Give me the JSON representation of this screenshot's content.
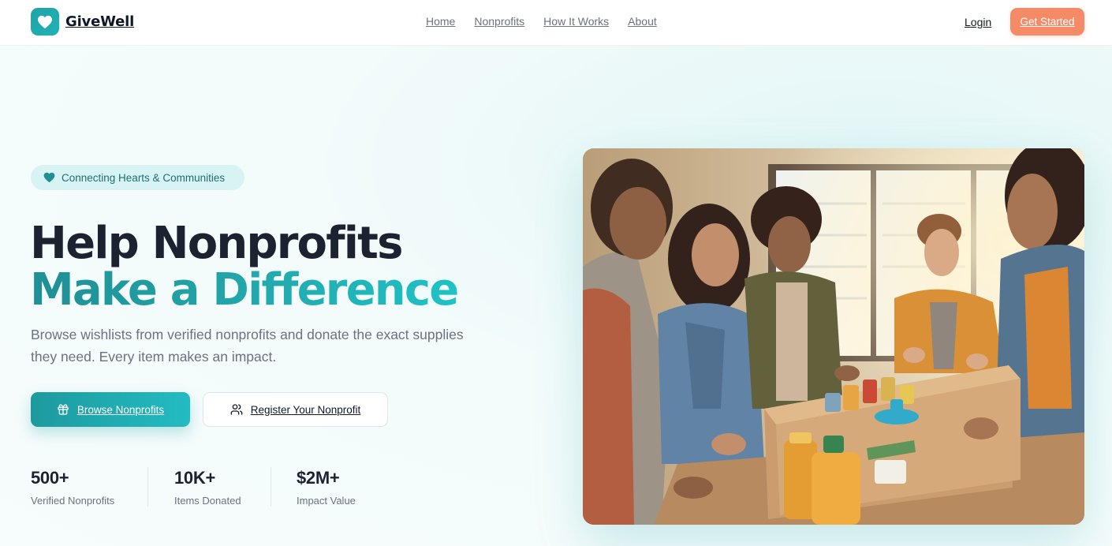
{
  "brand": {
    "name": "GiveWell",
    "logo_icon": "heart-icon"
  },
  "nav": {
    "links": [
      {
        "label": "Home"
      },
      {
        "label": "Nonprofits"
      },
      {
        "label": "How It Works"
      },
      {
        "label": "About"
      }
    ],
    "login_label": "Login",
    "cta_label": "Get Started"
  },
  "hero": {
    "badge": {
      "icon": "heart-icon",
      "text": "Connecting Hearts & Communities"
    },
    "title_line1": "Help Nonprofits",
    "title_line2": "Make a Difference",
    "subtitle": "Browse wishlists from verified nonprofits and donate the exact supplies they need. Every item makes an impact.",
    "primary_button": {
      "icon": "gift-icon",
      "label": "Browse Nonprofits"
    },
    "secondary_button": {
      "icon": "users-icon",
      "label": "Register Your Nonprofit"
    },
    "stats": [
      {
        "value": "500+",
        "label": "Verified Nonprofits"
      },
      {
        "value": "10K+",
        "label": "Items Donated"
      },
      {
        "value": "$2M+",
        "label": "Impact Value"
      }
    ]
  },
  "colors": {
    "accent": "#1fa3a5",
    "accent_light": "#22bcc2",
    "cta": "#f48b66",
    "heading": "#1b2230",
    "muted": "#6b7280",
    "badge_bg": "#d8f3f4"
  }
}
